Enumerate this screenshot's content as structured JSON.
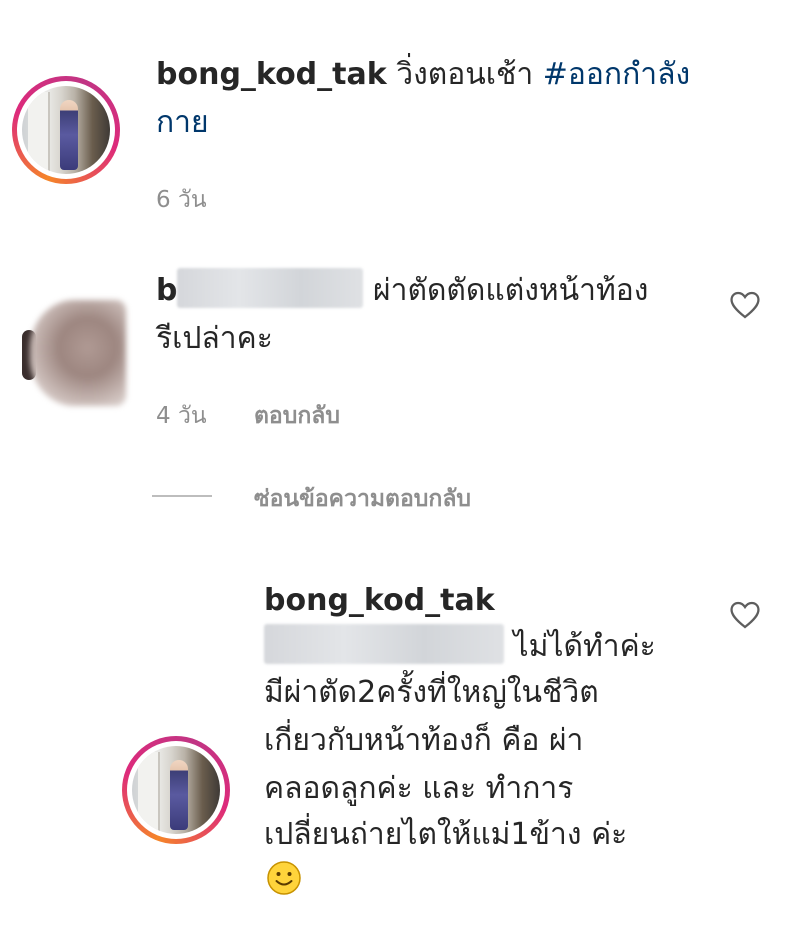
{
  "post": {
    "username": "bong_kod_tak",
    "caption_text": " วิ่งตอนเช้า ",
    "hashtag_line1": "#ออกกำลัง",
    "hashtag_line2": "กาย",
    "time": "6 วัน"
  },
  "comment": {
    "username_prefix": "b",
    "text_line1": "ผ่าตัดตัดแต่งหน้าท้อง",
    "text_line2": "รีเปล่าคะ",
    "time": "4 วัน",
    "reply_label": "ตอบกลับ",
    "hide_replies_label": "ซ่อนข้อความตอบกลับ"
  },
  "reply": {
    "username": "bong_kod_tak",
    "text_line1": "ไม่ได้ทำค่ะ",
    "text_line2": "มีผ่าตัด2ครั้งที่ใหญ่ในชีวิต",
    "text_line3": "เกี่ยวกับหน้าท้องก็ คือ ผ่า",
    "text_line4": "คลอดลูกค่ะ และ ทำการ",
    "text_line5": "เปลี่ยนถ่ายไตให้แม่1ข้าง ค่ะ"
  },
  "icons": {
    "heart": "heart-outline-icon",
    "emoji": "smiling-face-emoji"
  },
  "colors": {
    "hashtag": "#00376b",
    "meta_text": "#8e8e8e",
    "story_ring_start": "#f58529",
    "story_ring_end": "#dd2a7b"
  }
}
